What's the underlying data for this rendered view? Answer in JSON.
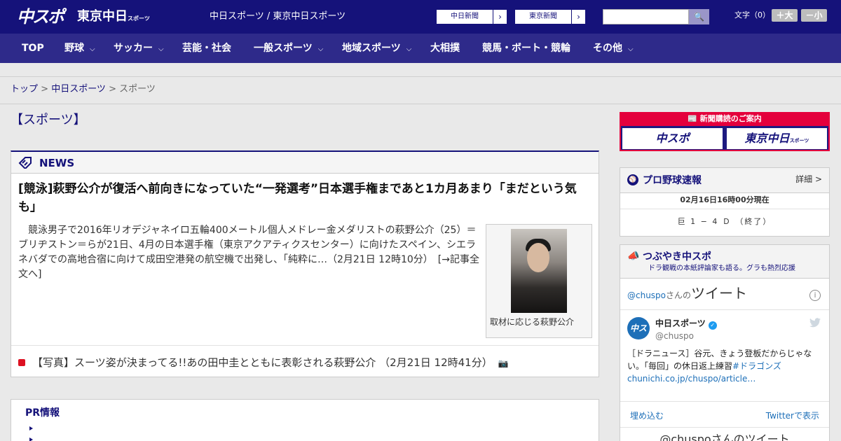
{
  "header": {
    "logo_primary": "中スポ",
    "logo_secondary": "東京中日",
    "logo_secondary_small": "スポーツ",
    "site_name": "中日スポーツ / 東京中日スポーツ",
    "ext_links": [
      {
        "label": "中日新聞",
        "arrow": "›"
      },
      {
        "label": "東京新聞",
        "arrow": "›"
      }
    ],
    "search_placeholder": "",
    "search_icon": "🔍",
    "font_size_label": "文字（0）",
    "font_larger": "＋大",
    "font_smaller": "－小"
  },
  "nav": [
    {
      "label": "TOP",
      "chevron": ""
    },
    {
      "label": "野球",
      "chevron": "⌵"
    },
    {
      "label": "サッカー",
      "chevron": "⌵"
    },
    {
      "label": "芸能・社会",
      "chevron": ""
    },
    {
      "label": "一般スポーツ",
      "chevron": "⌵"
    },
    {
      "label": "地域スポーツ",
      "chevron": "⌵"
    },
    {
      "label": "大相撲",
      "chevron": ""
    },
    {
      "label": "競馬・ボート・競輪",
      "chevron": ""
    },
    {
      "label": "その他",
      "chevron": "⌵"
    }
  ],
  "breadcrumb": {
    "home": "トップ",
    "sep": " > ",
    "section": "中日スポーツ",
    "current": "スポーツ"
  },
  "page_title": "【スポーツ】",
  "news": {
    "header_label": "NEWS",
    "headline": "[競泳]萩野公介が復活へ前向きになっていた“一発選考”日本選手権まであと1カ月あまり「まだという気も」",
    "body": "競泳男子で2016年リオデジャネイロ五輪400メートル個人メドレー金メダリストの萩野公介（25）＝ブリヂストン＝らが21日、4月の日本選手権（東京アクアティクスセンター）に向けたスペイン、シエラネバダでの高地合宿に向けて成田空港発の航空機で出発し、「純粋に…（2月21日 12時10分）　[→記事全文へ]",
    "photo_caption": "取材に応じる萩野公介",
    "related": "【写真】スーツ姿が決まってる!!あの田中圭とともに表彰される萩野公介 （2月21日 12時41分）",
    "related_icon": "📷"
  },
  "pr": {
    "title": "PR情報"
  },
  "subscribe": {
    "title": "📰 新聞購読のご案内",
    "btn1": "中スポ",
    "btn2": "東京中日",
    "btn2_small": "スポーツ"
  },
  "baseball": {
    "title": "プロ野球速報",
    "detail": "詳細 >",
    "timestamp": "02月16日16時00分現在",
    "score": "巨 1 − 4 Ｄ （終了）"
  },
  "twitter": {
    "title": "つぶやき中スポ",
    "subtitle": "ドラ観戦の本紙評論家も語る。グラも熱烈応援",
    "handle": "@chuspo",
    "handle_suffix": "さんの",
    "tweets_word": "ツイート",
    "info": "i",
    "account_name": "中日スポーツ",
    "verified": "✓",
    "account_handle": "@chuspo",
    "avatar_text": "中ス",
    "tweet_text": "［ドラニュース］谷元、きょう登板だからじゃない。「毎回」の休日返上練習",
    "tweet_hashtag": "#ドラゴンズ",
    "tweet_link": "chunichi.co.jp/chuspo/article…",
    "embed": "埋め込む",
    "view_on": "Twitterで表示",
    "more": "@chuspoさんのツイート"
  }
}
